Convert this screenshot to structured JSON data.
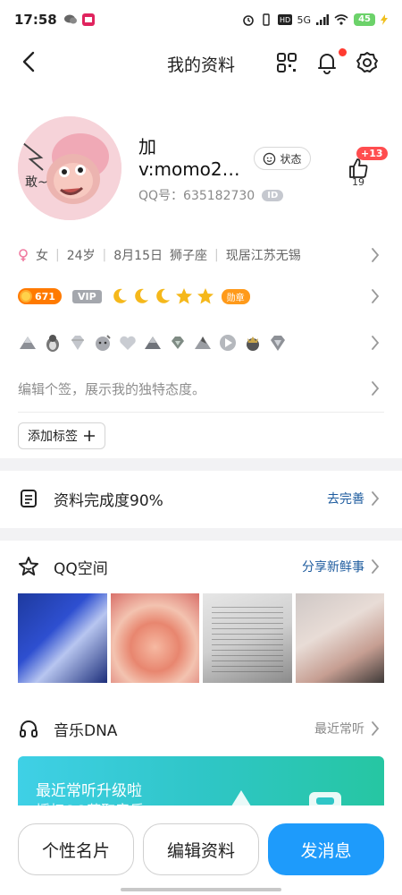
{
  "status_bar": {
    "time": "17:58",
    "network": "5G",
    "battery": "45"
  },
  "header": {
    "title": "我的资料",
    "icons": [
      "back-arrow-icon",
      "qr-code-icon",
      "bell-icon",
      "gear-icon"
    ]
  },
  "profile": {
    "name_line1": "加",
    "name_line2": "v:momo2…",
    "status_label": "状态",
    "qq_label": "QQ号：635182730",
    "id_badge": "ID",
    "like_badge": "+13",
    "like_count": "19"
  },
  "info": {
    "gender": "女",
    "age": "24岁",
    "birthday": "8月15日",
    "zodiac": "狮子座",
    "location": "现居江苏无锡"
  },
  "badges": {
    "coin_value": "671",
    "vip_label": "VIP",
    "medal_label": "勋章"
  },
  "signature": {
    "placeholder": "编辑个签，展示我的独特态度。"
  },
  "tags": {
    "add_label": "添加标签"
  },
  "completion": {
    "label": "资料完成度90%",
    "action": "去完善"
  },
  "qzone": {
    "title": "QQ空间",
    "action": "分享新鲜事"
  },
  "music": {
    "title": "音乐DNA",
    "action": "最近常听",
    "card_line1": "最近常听升级啦",
    "card_line2": "授权QQ获取音乐"
  },
  "bottom": {
    "card_button": "个性名片",
    "edit_button": "编辑资料",
    "message_button": "发消息"
  },
  "colors": {
    "accent_blue": "#1e9bfb",
    "link_blue": "#1d5b9e",
    "badge_red": "#ff4d4f",
    "coin_orange": "#ff7a00"
  }
}
